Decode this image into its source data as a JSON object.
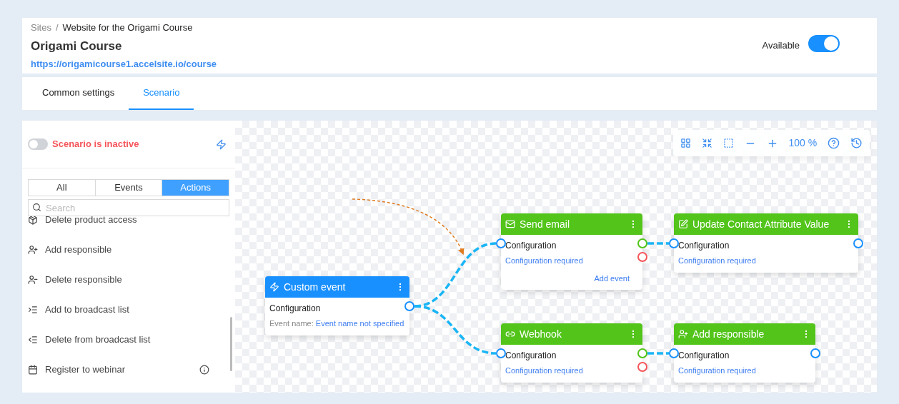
{
  "breadcrumb": {
    "parent": "Sites",
    "separator": "/",
    "current": "Website for the Origami Course"
  },
  "site": {
    "title": "Origami Course",
    "url": "https://origamicourse1.accelsite.io/course",
    "available_label": "Available",
    "available": true
  },
  "tabs": [
    {
      "label": "Common settings",
      "selected": false
    },
    {
      "label": "Scenario",
      "selected": true
    }
  ],
  "sidebar": {
    "status_label": "Scenario is inactive",
    "active": false,
    "filters": [
      {
        "label": "All",
        "selected": false
      },
      {
        "label": "Events",
        "selected": false
      },
      {
        "label": "Actions",
        "selected": true
      }
    ],
    "search": {
      "placeholder": "Search"
    },
    "items": [
      {
        "label": "Delete product access",
        "kind": "box",
        "info": false
      },
      {
        "label": "Add responsible",
        "kind": "user-add",
        "info": false
      },
      {
        "label": "Delete responsible",
        "kind": "user-remove",
        "info": false
      },
      {
        "label": "Add to broadcast list",
        "kind": "list-add",
        "info": false
      },
      {
        "label": "Delete from broadcast list",
        "kind": "list-remove",
        "info": false
      },
      {
        "label": "Register to webinar",
        "kind": "calendar",
        "info": true
      }
    ]
  },
  "toolbar": {
    "zoom": "100 %"
  },
  "nodes": [
    {
      "title": "Custom event",
      "kind": "event",
      "config": "Configuration",
      "detail_label": "Event name:",
      "detail": "Event name not specified",
      "error_port": false
    },
    {
      "title": "Send email",
      "kind": "action",
      "config": "Configuration",
      "detail": "Configuration required",
      "link": "Add event",
      "error_port": true
    },
    {
      "title": "Update Contact Attribute Value",
      "kind": "action",
      "config": "Configuration",
      "detail": "Configuration required",
      "error_port": false
    },
    {
      "title": "Webhook",
      "kind": "action",
      "config": "Configuration",
      "detail": "Configuration required",
      "error_port": true
    },
    {
      "title": "Add responsible",
      "kind": "action",
      "config": "Configuration",
      "detail": "Configuration required",
      "error_port": false
    }
  ]
}
